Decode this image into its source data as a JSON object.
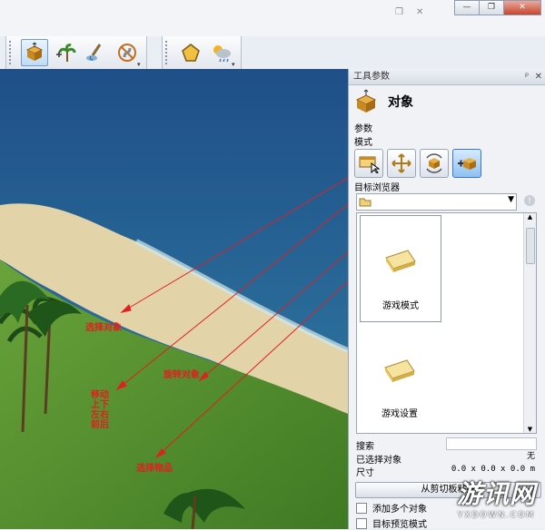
{
  "window": {
    "minimize": "—",
    "restore": "❐",
    "close": "✕"
  },
  "toolbar": {
    "buttons": [
      {
        "name": "object-tool-icon",
        "active": true
      },
      {
        "name": "plant-tool-icon",
        "active": false
      },
      {
        "name": "paint-tool-icon",
        "active": false
      },
      {
        "name": "road-tool-icon",
        "active": false
      },
      {
        "name": "shape-tool-icon",
        "active": false
      },
      {
        "name": "weather-tool-icon",
        "active": false
      }
    ]
  },
  "panel": {
    "title": "工具参数",
    "object_heading": "对象",
    "params_label": "参数",
    "mode_label": "模式",
    "browser_label": "目标浏览器",
    "tiles": [
      {
        "caption": "游戏模式"
      },
      {
        "caption": "游戏设置"
      }
    ],
    "search_label": "搜索",
    "selected_label": "已选择对象",
    "selected_value": "无",
    "size_label": "尺寸",
    "size_value": "0.0 x 0.0 x 0.0 m",
    "clipboard_button": "从剪切板粘贴",
    "add_multiple": "添加多个对象",
    "target_preview": "目标预览模式"
  },
  "annotations": {
    "select_object": "选择对象",
    "rotate_object": "旋转对象",
    "move_label": "移动\n上下\n左右\n前后",
    "select_item": "选择物品"
  },
  "watermark": {
    "main": "游讯网",
    "sub": "YXDOWN.COM"
  },
  "colors": {
    "accent": "#3b78c4",
    "annotation": "#e02020"
  }
}
